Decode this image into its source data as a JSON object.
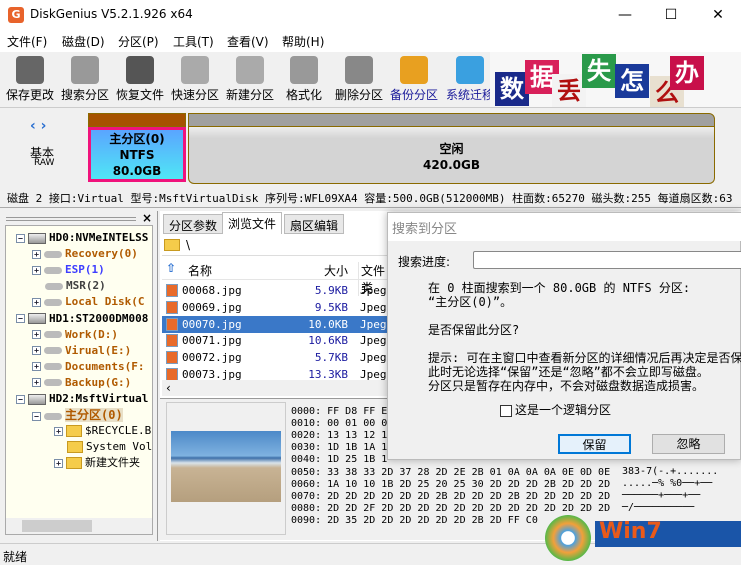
{
  "window": {
    "title": "DiskGenius V5.2.1.926 x64",
    "app_icon": "G",
    "minimize": "—",
    "maximize": "☐",
    "close": "✕"
  },
  "menu": [
    "文件(F)",
    "磁盘(D)",
    "分区(P)",
    "工具(T)",
    "查看(V)",
    "帮助(H)"
  ],
  "toolbar": [
    {
      "label": "保存更改",
      "icon": "save-icon",
      "color": "#666666"
    },
    {
      "label": "搜索分区",
      "icon": "magnifier-icon",
      "color": "#999999"
    },
    {
      "label": "恢复文件",
      "icon": "restore-icon",
      "color": "#555555"
    },
    {
      "label": "快速分区",
      "icon": "disc-icon",
      "color": "#aaaaaa"
    },
    {
      "label": "新建分区",
      "icon": "laptop-icon",
      "color": "#aaaaaa"
    },
    {
      "label": "格式化",
      "icon": "format-icon",
      "color": "#999999"
    },
    {
      "label": "删除分区",
      "icon": "trash-icon",
      "color": "#888888"
    },
    {
      "label": "备份分区",
      "icon": "backup-icon",
      "color": "#e8a020"
    },
    {
      "label": "系统迁移",
      "icon": "migrate-icon",
      "color": "#3aa0e0"
    }
  ],
  "banner": {
    "chars": [
      "数",
      "据",
      "丢",
      "失",
      "怎",
      "么",
      "办"
    ]
  },
  "diskmap": {
    "type": "基本",
    "format": "RAW",
    "partitions": [
      {
        "name": "主分区(0)",
        "fs": "NTFS",
        "size": "80.0GB"
      },
      {
        "name": "空闲",
        "size": "420.0GB"
      }
    ]
  },
  "diskinfo": "磁盘 2 接口:Virtual  型号:MsftVirtualDisk  序列号:WFL09XA4  容量:500.0GB(512000MB)  柱面数:65270  磁头数:255  每道扇区数:63",
  "tree": {
    "close": "×",
    "nodes": [
      {
        "label": "HD0:NVMeINTELSS",
        "kind": "disk",
        "color": "#000000"
      },
      {
        "label": "Recovery(0)",
        "kind": "vol",
        "color": "#b05a00"
      },
      {
        "label": "ESP(1)",
        "kind": "vol",
        "color": "#3d3dff"
      },
      {
        "label": "MSR(2)",
        "kind": "vol",
        "color": "#404040"
      },
      {
        "label": "Local Disk(C",
        "kind": "vol",
        "color": "#b05a00"
      },
      {
        "label": "HD1:ST2000DM008",
        "kind": "disk",
        "color": "#000000"
      },
      {
        "label": "Work(D:)",
        "kind": "vol",
        "color": "#b05a00"
      },
      {
        "label": "Virual(E:)",
        "kind": "vol",
        "color": "#b05a00"
      },
      {
        "label": "Documents(F:",
        "kind": "vol",
        "color": "#b05a00"
      },
      {
        "label": "Backup(G:)",
        "kind": "vol",
        "color": "#b05a00"
      },
      {
        "label": "HD2:MsftVirtual",
        "kind": "disk",
        "color": "#000000"
      },
      {
        "label": "主分区(0)",
        "kind": "vol",
        "color": "#b05a00"
      },
      {
        "label": "$RECYCLE.BI",
        "kind": "folder",
        "color": "#000000"
      },
      {
        "label": "System Volu",
        "kind": "folder",
        "color": "#000000"
      },
      {
        "label": "新建文件夹",
        "kind": "folder",
        "color": "#000000"
      }
    ]
  },
  "tabs": [
    "分区参数",
    "浏览文件",
    "扇区编辑"
  ],
  "path": "\\",
  "filelist": {
    "columns": [
      "名称",
      "大小",
      "文件类"
    ],
    "rows": [
      {
        "name": "00068.jpg",
        "size": "5.9KB",
        "type": "Jpeg"
      },
      {
        "name": "00069.jpg",
        "size": "9.5KB",
        "type": "Jpeg"
      },
      {
        "name": "00070.jpg",
        "size": "10.0KB",
        "type": "Jpeg",
        "selected": true
      },
      {
        "name": "00071.jpg",
        "size": "10.6KB",
        "type": "Jpeg"
      },
      {
        "name": "00072.jpg",
        "size": "5.7KB",
        "type": "Jpeg"
      },
      {
        "name": "00073.jpg",
        "size": "13.3KB",
        "type": "Jpeg"
      }
    ]
  },
  "hex": [
    "0000: FF D8 FF E",
    "0010: 00 01 00 0",
    "0020: 13 13 12 1",
    "0030: 1D 1B 1A 1",
    "0040: 1D 25 1B 1",
    "0050: 33 38 33 2D 37 28 2D 2E 2B 01 0A 0A 0A 0E 0D 0E",
    "0060: 1A 10 10 1B 2D 25 20 25 30 2D 2D 2D 2B 2D 2D 2D",
    "0070: 2D 2D 2D 2D 2D 2D 2B 2D 2D 2D 2B 2D 2D 2D 2D 2D",
    "0080: 2D 2D 2F 2D 2D 2D 2D 2D 2D 2D 2D 2D 2D 2D 2D 2D",
    "0090: 2D 35 2D 2D 2D 2D 2D 2D 2B 2D FF C0"
  ],
  "ascii": [
    "383-7(-.+.......",
    ".....─% %0──+──",
    "──────+───+──",
    "─/──────────"
  ],
  "dialog": {
    "title": "搜索到分区",
    "progress_label": "搜索进度:",
    "progress": 0,
    "line1": "在 0 柱面搜索到一个 80.0GB 的 NTFS 分区:",
    "line2": "“主分区(0)”。",
    "question": "是否保留此分区?",
    "hint1": "提示: 可在主窗口中查看新分区的详细情况后再决定是否保",
    "hint2": "此时无论选择“保留”还是“忽略”都不会立即写磁盘。",
    "hint3": "分区只是暂存在内存中，不会对磁盘数据造成损害。",
    "checkbox": "这是一个逻辑分区",
    "checked": false,
    "keep": "保留",
    "ignore": "忽略"
  },
  "status": "就绪",
  "watermark": "Win7"
}
